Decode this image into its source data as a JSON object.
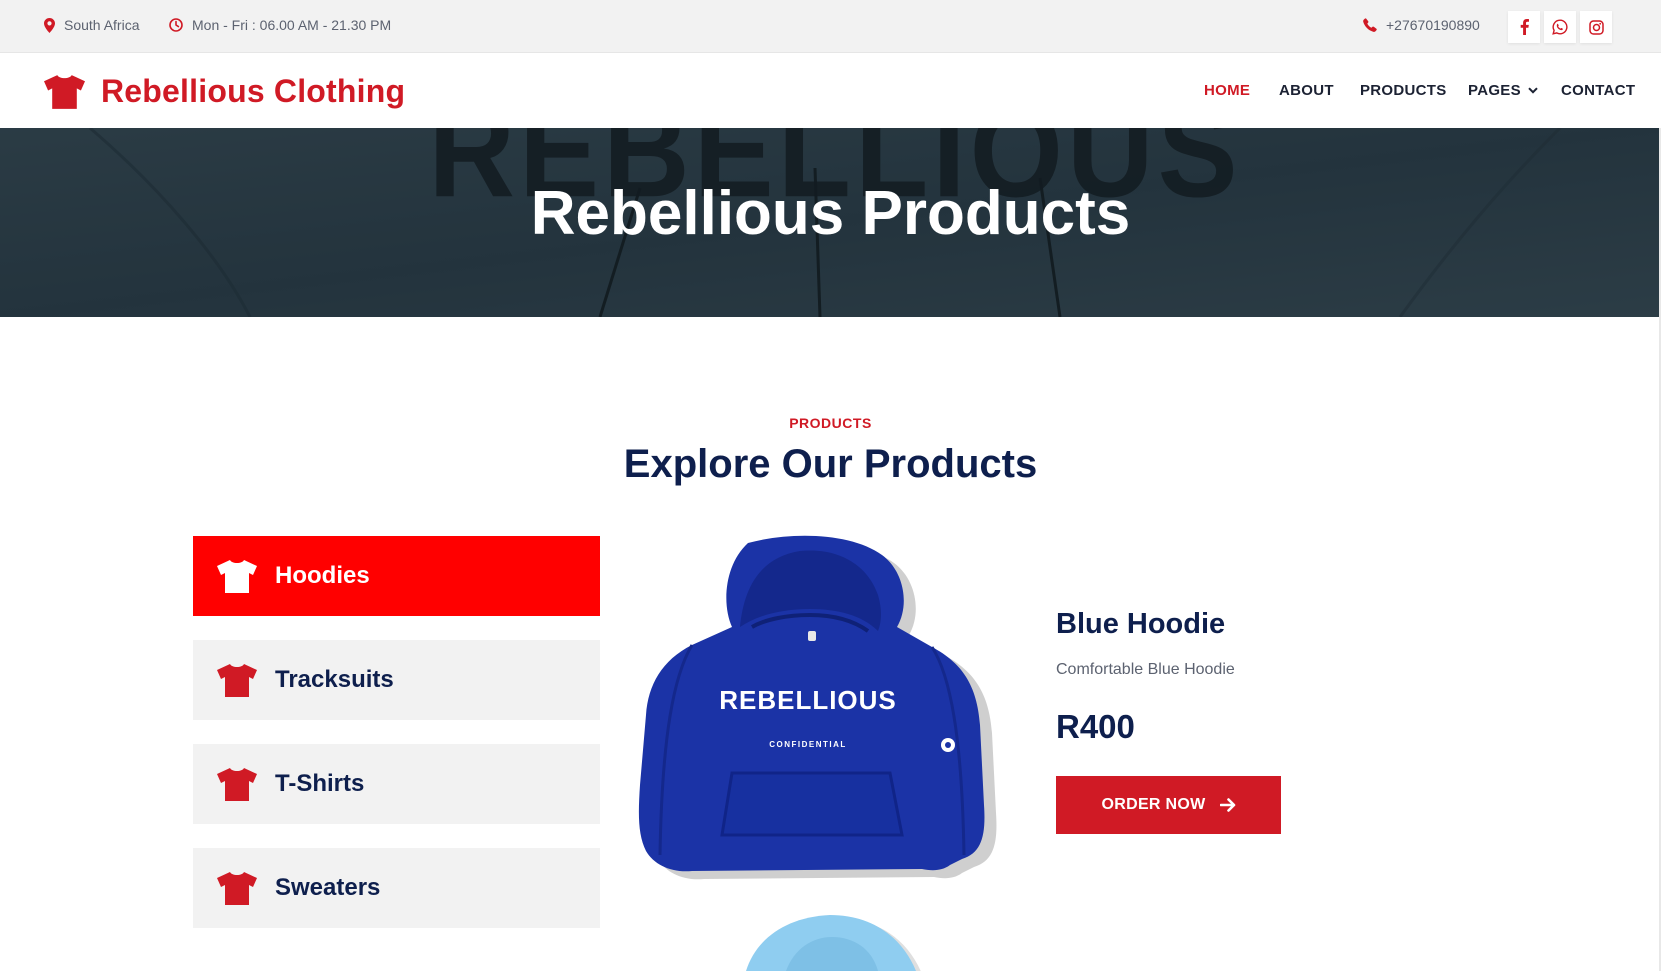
{
  "topbar": {
    "location": "South Africa",
    "hours": "Mon - Fri : 06.00 AM - 21.30 PM",
    "phone": "+27670190890",
    "socials": [
      "facebook-icon",
      "whatsapp-icon",
      "instagram-icon"
    ]
  },
  "brand": {
    "name": "Rebellious Clothing"
  },
  "nav": {
    "home": "HOME",
    "about": "ABOUT",
    "products": "PRODUCTS",
    "pages": "PAGES",
    "contact": "CONTACT"
  },
  "hero": {
    "title": "Rebellious Products",
    "background_text": "REBELLIOUS"
  },
  "section": {
    "label": "PRODUCTS",
    "title": "Explore Our Products"
  },
  "categories": [
    {
      "label": "Hoodies",
      "active": true
    },
    {
      "label": "Tracksuits",
      "active": false
    },
    {
      "label": "T-Shirts",
      "active": false
    },
    {
      "label": "Sweaters",
      "active": false
    }
  ],
  "product": {
    "name": "Blue Hoodie",
    "description": "Comfortable Blue Hoodie",
    "price": "R400",
    "cta": "ORDER NOW",
    "print_main": "REBELLIOUS",
    "print_sub": "CONFIDENTIAL"
  },
  "colors": {
    "accent": "#d01a25",
    "active_tab": "#ff0000",
    "navy": "#0e1f4d",
    "hoodie_blue": "#1b33a6",
    "hoodie_light": "#8fcdf0"
  }
}
